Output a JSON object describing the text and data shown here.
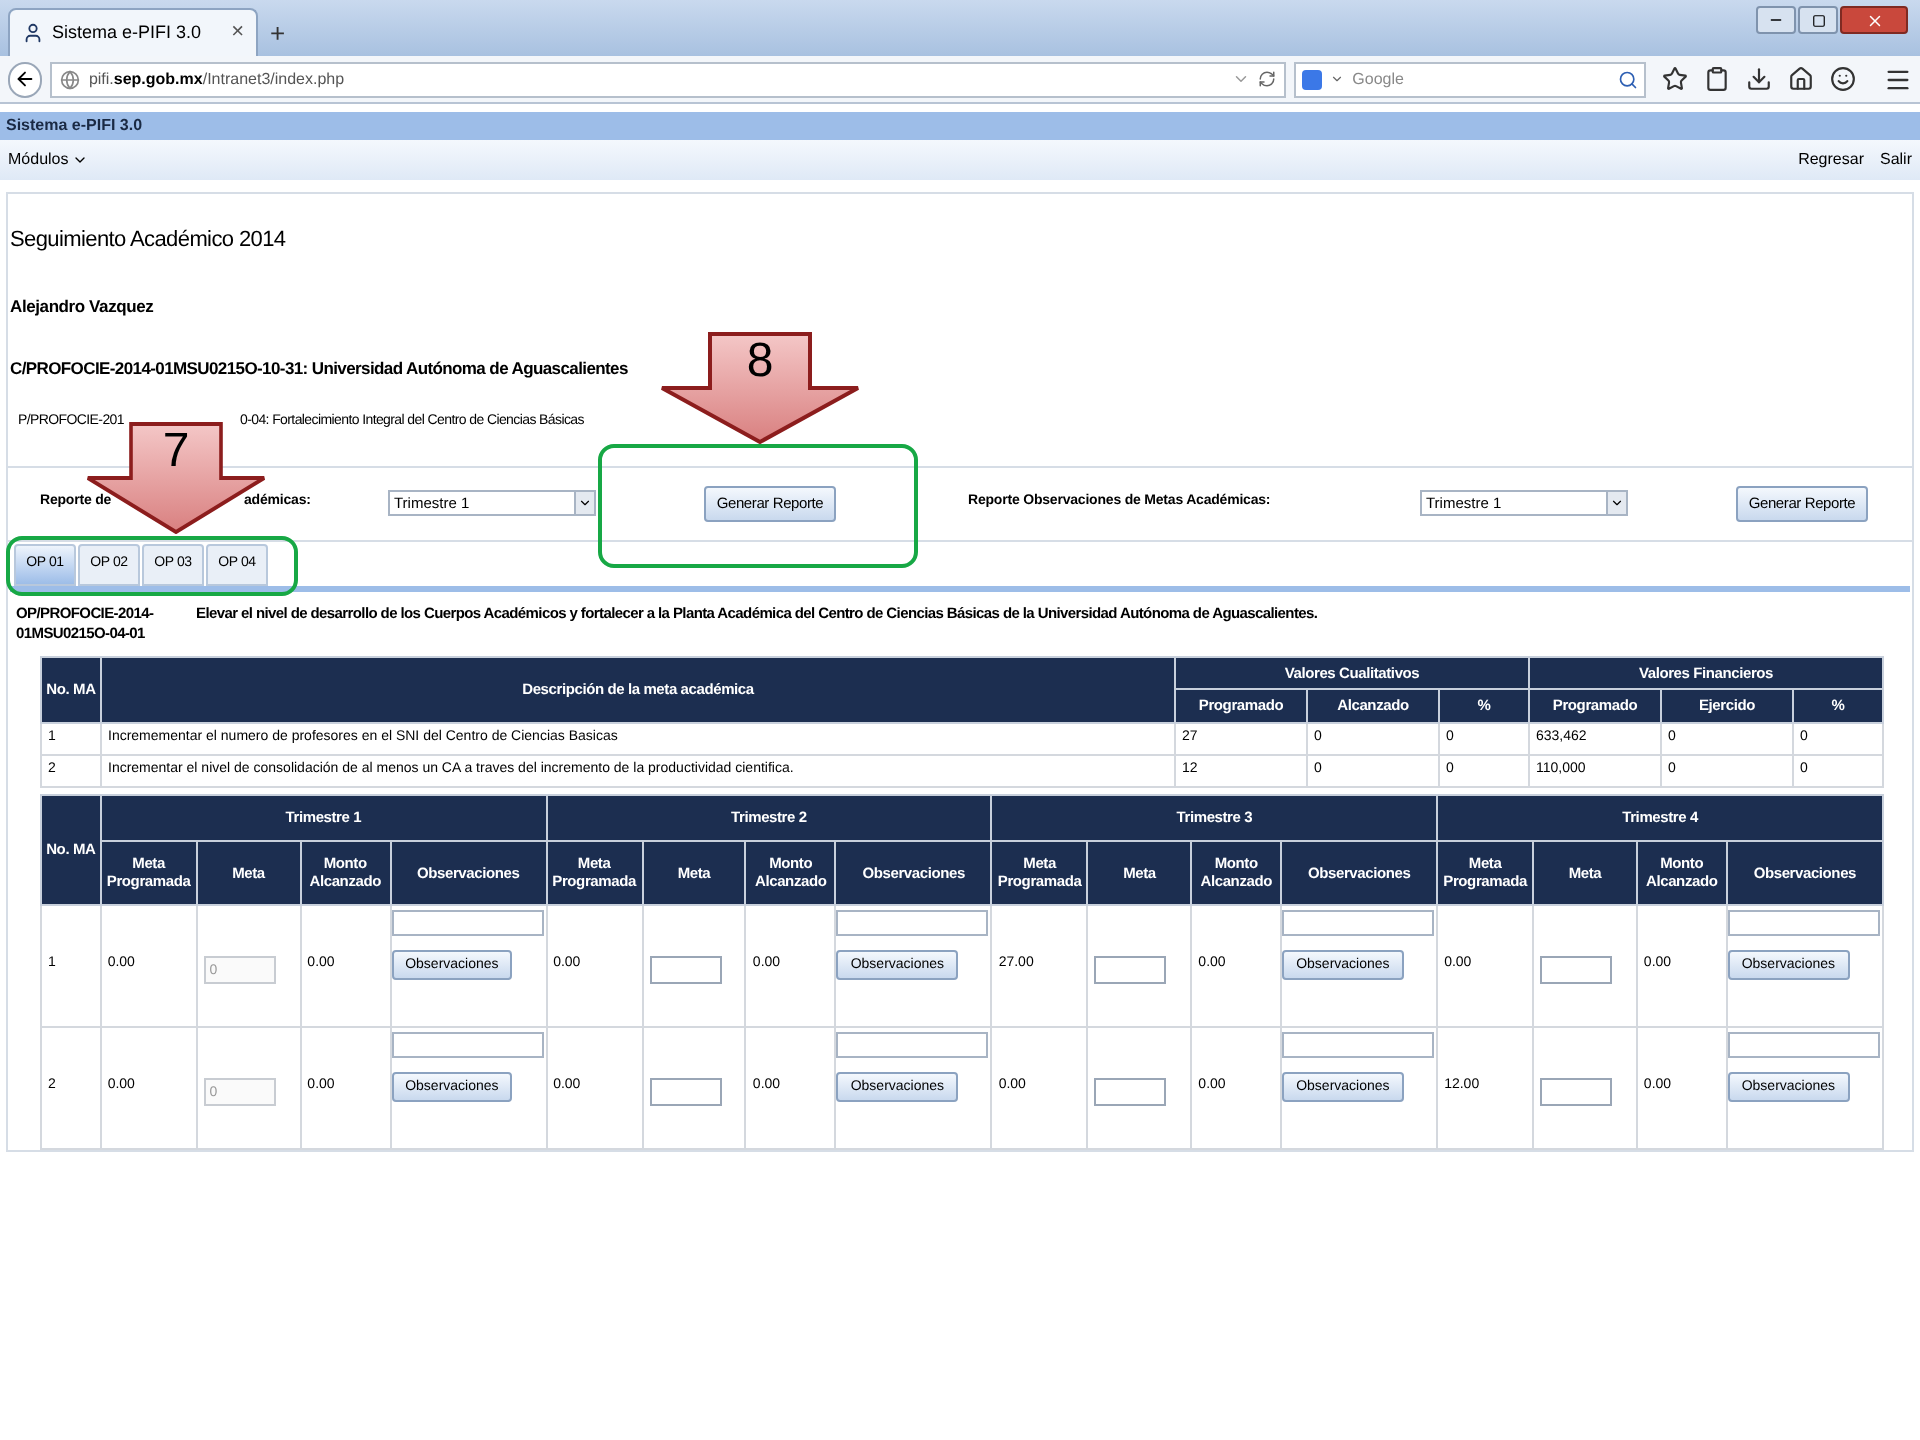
{
  "browser": {
    "tab_title": "Sistema e-PIFI 3.0",
    "tab_close": "×",
    "new_tab": "+",
    "url_start": "pifi.",
    "url_host": "sep.gob.mx",
    "url_path": "/Intranet3/index.php",
    "search_placeholder": "Google"
  },
  "app": {
    "title": "Sistema e-PIFI 3.0",
    "menu": "Módulos",
    "links": [
      "Regresar",
      "Salir"
    ]
  },
  "page": {
    "title": "Seguimiento Académico 2014",
    "user": "Alejandro Vazquez",
    "c_line": "C/PROFOCIE-2014-01MSU0215O-10-31: Universidad Autónoma de Aguascalientes",
    "p_line_parts": [
      "P/PROFOCIE-201",
      "0-04: Fortalecimiento Integral del Centro de Ciencias Básicas"
    ]
  },
  "reports": [
    {
      "label_parts": [
        "Reporte de",
        "adémicas:"
      ],
      "select": "Trimestre 1",
      "button": "Generar Reporte"
    },
    {
      "label_parts": [
        "Reporte Observaciones de Metas Académicas:"
      ],
      "select": "Trimestre 1",
      "button": "Generar Reporte"
    }
  ],
  "tabs": [
    {
      "label": "OP 01",
      "selected": true
    },
    {
      "label": "OP 02",
      "selected": false
    },
    {
      "label": "OP 03",
      "selected": false
    },
    {
      "label": "OP 04",
      "selected": false
    }
  ],
  "objective": {
    "code": "OP/PROFOCIE-2014-01MSU0215O-04-01",
    "text": "Elevar el nivel de desarrollo de los Cuerpos Académicos y fortalecer a la Planta Académica del Centro de Ciencias Básicas de la Universidad Autónoma de Aguascalientes."
  },
  "goals_table": {
    "col_no": "No. MA",
    "col_desc": "Descripción de la meta académica",
    "groups": [
      {
        "title": "Valores Cualitativos",
        "columns": [
          "Programado",
          "Alcanzado",
          "%"
        ]
      },
      {
        "title": "Valores Financieros",
        "columns": [
          "Programado",
          "Ejercido",
          "%"
        ]
      }
    ],
    "rows": [
      {
        "no": "1",
        "desc": "Incremementar el numero de profesores en el SNI del Centro de Ciencias Basicas",
        "values": [
          "27",
          "0",
          "0",
          "633,462",
          "0",
          "0"
        ]
      },
      {
        "no": "2",
        "desc": "Incrementar el nivel de consolidación de al menos un CA a traves del incremento de la productividad cientifica.",
        "values": [
          "12",
          "0",
          "0",
          "110,000",
          "0",
          "0"
        ]
      }
    ]
  },
  "quarter_table": {
    "col_no": "No. MA",
    "quarters": [
      {
        "title": "Trimestre 1",
        "columns": [
          "Meta Programada",
          "Meta",
          "Monto Alcanzado",
          "Observaciones"
        ]
      },
      {
        "title": "Trimestre 2",
        "columns": [
          "Meta Programada",
          "Meta",
          "Monto Alcanzado",
          "Observaciones"
        ]
      },
      {
        "title": "Trimestre 3",
        "columns": [
          "Meta Programada",
          "Meta",
          "Monto Alcanzado",
          "Observaciones"
        ]
      },
      {
        "title": "Trimestre 4",
        "columns": [
          "Meta Programada",
          "Meta",
          "Monto Alcanzado",
          "Observaciones"
        ]
      }
    ],
    "rows": [
      {
        "no": "1",
        "cells": [
          {
            "programada": "0.00",
            "placeholder": "0",
            "disabled": true,
            "monto": "0.00",
            "button": "Observaciones"
          },
          {
            "programada": "0.00",
            "disabled": false,
            "monto": "0.00",
            "button": "Observaciones"
          },
          {
            "programada": "27.00",
            "disabled": false,
            "monto": "0.00",
            "button": "Observaciones"
          },
          {
            "programada": "0.00",
            "disabled": false,
            "monto": "0.00",
            "button": "Observaciones"
          }
        ]
      },
      {
        "no": "2",
        "cells": [
          {
            "programada": "0.00",
            "placeholder": "0",
            "disabled": true,
            "monto": "0.00",
            "button": "Observaciones"
          },
          {
            "programada": "0.00",
            "disabled": false,
            "monto": "0.00",
            "button": "Observaciones"
          },
          {
            "programada": "0.00",
            "disabled": false,
            "monto": "0.00",
            "button": "Observaciones"
          },
          {
            "programada": "12.00",
            "disabled": false,
            "monto": "0.00",
            "button": "Observaciones"
          }
        ]
      }
    ]
  },
  "callouts": [
    {
      "number": "7",
      "kind": "tabs"
    },
    {
      "number": "8",
      "kind": "button"
    }
  ]
}
